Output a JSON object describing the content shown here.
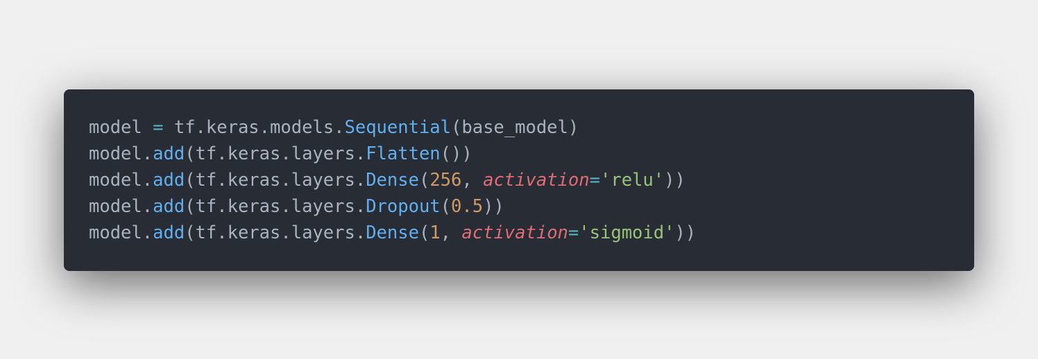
{
  "colors": {
    "page_background": "#f0f0f0",
    "editor_background": "#282c34",
    "plain": "#abb2bf",
    "operator": "#56b6c2",
    "function": "#61afef",
    "number": "#d19a66",
    "parameter": "#e06c75",
    "string": "#98c379"
  },
  "code": {
    "language": "python",
    "lines": [
      [
        {
          "text": "model ",
          "type": "plain"
        },
        {
          "text": "=",
          "type": "operator"
        },
        {
          "text": " tf.keras.models.",
          "type": "plain"
        },
        {
          "text": "Sequential",
          "type": "function"
        },
        {
          "text": "(base_model)",
          "type": "plain"
        }
      ],
      [
        {
          "text": "model.",
          "type": "plain"
        },
        {
          "text": "add",
          "type": "function"
        },
        {
          "text": "(tf.keras.layers.",
          "type": "plain"
        },
        {
          "text": "Flatten",
          "type": "function"
        },
        {
          "text": "())",
          "type": "plain"
        }
      ],
      [
        {
          "text": "model.",
          "type": "plain"
        },
        {
          "text": "add",
          "type": "function"
        },
        {
          "text": "(tf.keras.layers.",
          "type": "plain"
        },
        {
          "text": "Dense",
          "type": "function"
        },
        {
          "text": "(",
          "type": "plain"
        },
        {
          "text": "256",
          "type": "number"
        },
        {
          "text": ", ",
          "type": "plain"
        },
        {
          "text": "activation",
          "type": "param"
        },
        {
          "text": "=",
          "type": "operator"
        },
        {
          "text": "'relu'",
          "type": "string"
        },
        {
          "text": "))",
          "type": "plain"
        }
      ],
      [
        {
          "text": "model.",
          "type": "plain"
        },
        {
          "text": "add",
          "type": "function"
        },
        {
          "text": "(tf.keras.layers.",
          "type": "plain"
        },
        {
          "text": "Dropout",
          "type": "function"
        },
        {
          "text": "(",
          "type": "plain"
        },
        {
          "text": "0.5",
          "type": "number"
        },
        {
          "text": "))",
          "type": "plain"
        }
      ],
      [
        {
          "text": "model.",
          "type": "plain"
        },
        {
          "text": "add",
          "type": "function"
        },
        {
          "text": "(tf.keras.layers.",
          "type": "plain"
        },
        {
          "text": "Dense",
          "type": "function"
        },
        {
          "text": "(",
          "type": "plain"
        },
        {
          "text": "1",
          "type": "number"
        },
        {
          "text": ", ",
          "type": "plain"
        },
        {
          "text": "activation",
          "type": "param"
        },
        {
          "text": "=",
          "type": "operator"
        },
        {
          "text": "'sigmoid'",
          "type": "string"
        },
        {
          "text": "))",
          "type": "plain"
        }
      ]
    ]
  }
}
